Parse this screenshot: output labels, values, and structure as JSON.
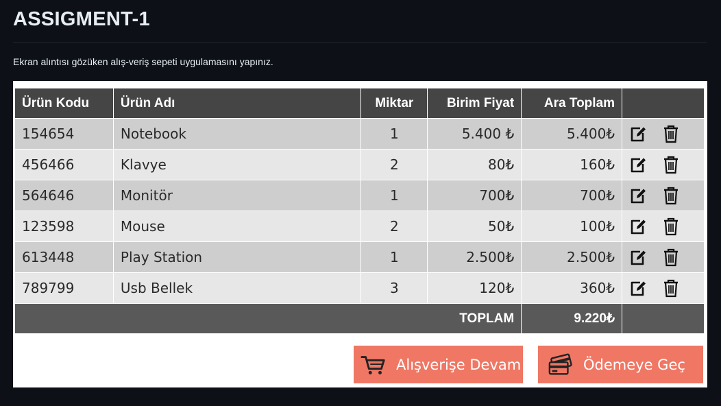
{
  "page": {
    "title": "ASSIGMENT-1",
    "subtitle": "Ekran alıntısı gözüken alış-veriş sepeti uygulamasını yapınız."
  },
  "table": {
    "headers": {
      "code": "Ürün Kodu",
      "name": "Ürün Adı",
      "qty": "Miktar",
      "unit_price": "Birim Fiyat",
      "subtotal": "Ara Toplam",
      "actions": ""
    },
    "rows": [
      {
        "code": "154654",
        "name": "Notebook",
        "qty": "1",
        "unit_price": "5.400 ₺",
        "subtotal": "5.400₺"
      },
      {
        "code": "456466",
        "name": "Klavye",
        "qty": "2",
        "unit_price": "80₺",
        "subtotal": "160₺"
      },
      {
        "code": "564646",
        "name": "Monitör",
        "qty": "1",
        "unit_price": "700₺",
        "subtotal": "700₺"
      },
      {
        "code": "123598",
        "name": "Mouse",
        "qty": "2",
        "unit_price": "50₺",
        "subtotal": "100₺"
      },
      {
        "code": "613448",
        "name": "Play Station",
        "qty": "1",
        "unit_price": "2.500₺",
        "subtotal": "2.500₺"
      },
      {
        "code": "789799",
        "name": "Usb Bellek",
        "qty": "3",
        "unit_price": "120₺",
        "subtotal": "360₺"
      }
    ],
    "footer": {
      "label": "TOPLAM",
      "total": "9.220₺"
    },
    "row_action_icons": [
      "edit-icon",
      "trash-icon"
    ]
  },
  "buttons": {
    "continue_label": "Alışverişe Devam",
    "continue_icon": "cart-icon",
    "checkout_label": "Ödemeye Geç",
    "checkout_icon": "credit-card-icon"
  },
  "colors": {
    "background": "#0d1117",
    "header_bg": "#454545",
    "footer_bg": "#595959",
    "row_odd": "#cecece",
    "row_even": "#e7e7e7",
    "button": "#ef7764"
  }
}
